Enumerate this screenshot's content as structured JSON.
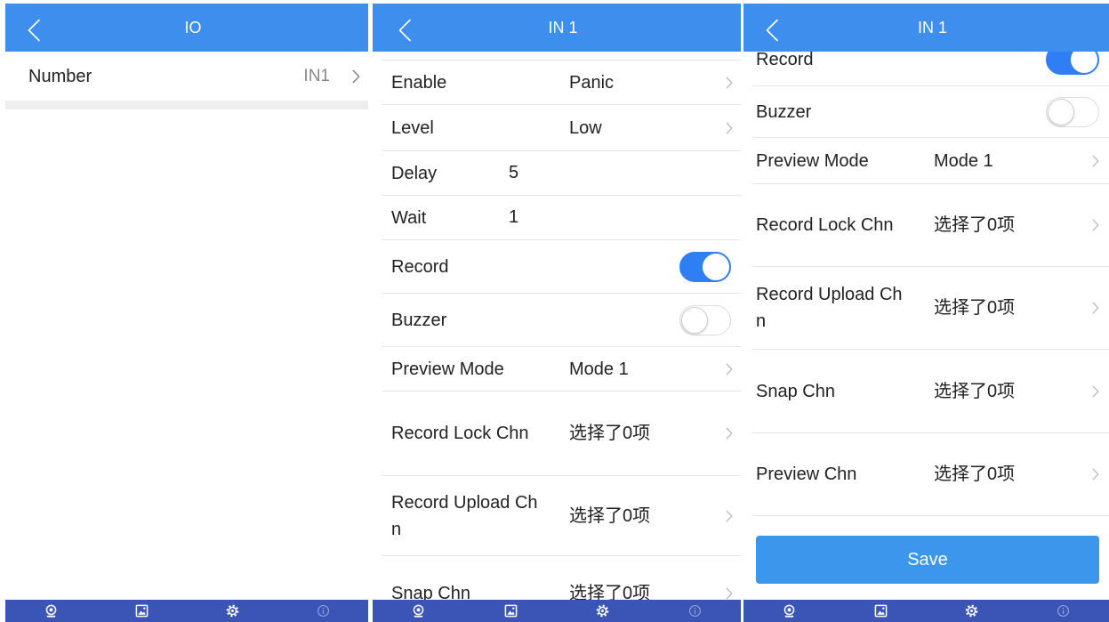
{
  "colors": {
    "header": "#3d8eed",
    "tabbar": "#3b55b7",
    "toggle_on": "#2f7ef3",
    "save_button": "#3b96ec",
    "text": "#222222",
    "separator": "#e6e6e6",
    "section_band": "#eeeeee"
  },
  "tabbar": {
    "items": [
      {
        "icon": "camera-icon",
        "dimmed": false
      },
      {
        "icon": "image-icon",
        "dimmed": false
      },
      {
        "icon": "gear-icon",
        "dimmed": false
      },
      {
        "icon": "info-icon",
        "dimmed": true
      }
    ]
  },
  "io_screen": {
    "title": "IO",
    "number": {
      "label": "Number",
      "value": "IN1"
    }
  },
  "in1_screen_top": {
    "title": "IN 1",
    "enable": {
      "label": "Enable",
      "value": "Panic"
    },
    "level": {
      "label": "Level",
      "value": "Low"
    },
    "delay": {
      "label": "Delay",
      "value": "5"
    },
    "wait": {
      "label": "Wait",
      "value": "1"
    },
    "record": {
      "label": "Record",
      "on": true
    },
    "buzzer": {
      "label": "Buzzer",
      "on": false
    },
    "preview_mode": {
      "label": "Preview Mode",
      "value": "Mode 1"
    },
    "record_lock_chn": {
      "label": "Record Lock Chn",
      "value": "选择了0项"
    },
    "record_upload_chn": {
      "label": "Record Upload Chn",
      "value": "选择了0项"
    },
    "snap_chn": {
      "label": "Snap Chn",
      "value": "选择了0项"
    }
  },
  "in1_screen_bottom": {
    "title": "IN 1",
    "record": {
      "label": "Record",
      "on": true
    },
    "buzzer": {
      "label": "Buzzer",
      "on": false
    },
    "preview_mode": {
      "label": "Preview Mode",
      "value": "Mode 1"
    },
    "record_lock_chn": {
      "label": "Record Lock Chn",
      "value": "选择了0项"
    },
    "record_upload_chn": {
      "label": "Record Upload Chn",
      "value": "选择了0项"
    },
    "snap_chn": {
      "label": "Snap Chn",
      "value": "选择了0项"
    },
    "preview_chn": {
      "label": "Preview Chn",
      "value": "选择了0项"
    },
    "save_label": "Save"
  }
}
